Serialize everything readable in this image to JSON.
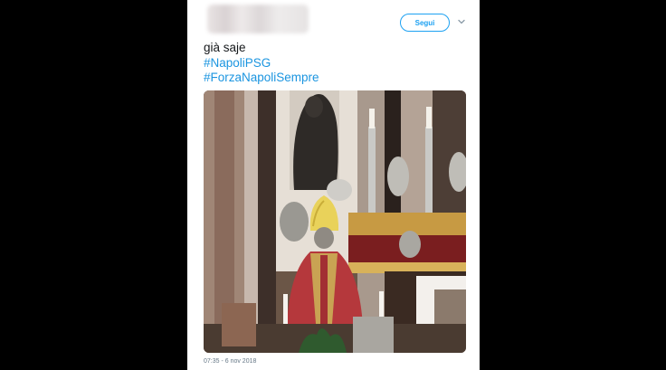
{
  "header": {
    "follow_label": "Segui"
  },
  "tweet": {
    "text": "già saje",
    "hashtags": [
      "#NapoliPSG",
      "#ForzaNapoliSempre"
    ],
    "timestamp": "07:35 - 6 nov 2018"
  },
  "photo": {
    "description_icon": "image-icon"
  },
  "colors": {
    "accent": "#1da1f2",
    "hashtag": "#1b95e0",
    "text": "#14171a",
    "muted": "#657786",
    "backdrop": "#000000"
  }
}
